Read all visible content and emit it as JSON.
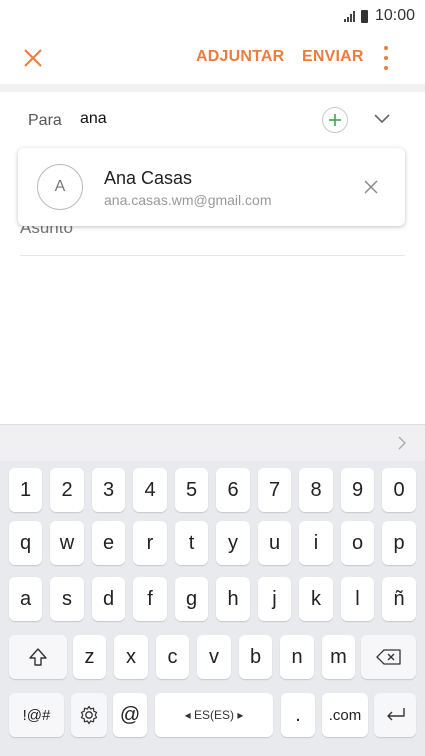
{
  "status": {
    "time": "10:00"
  },
  "action_bar": {
    "attach_label": "ADJUNTAR",
    "send_label": "ENVIAR",
    "accent_color": "#ef7c3a"
  },
  "recipient": {
    "label": "Para",
    "value": "ana"
  },
  "suggestion": {
    "avatar_letter": "A",
    "name": "Ana Casas",
    "email": "ana.casas.wm@gmail.com"
  },
  "subject": {
    "placeholder": "Asunto"
  },
  "keyboard": {
    "row_numbers": [
      "1",
      "2",
      "3",
      "4",
      "5",
      "6",
      "7",
      "8",
      "9",
      "0"
    ],
    "row_top": [
      "q",
      "w",
      "e",
      "r",
      "t",
      "y",
      "u",
      "i",
      "o",
      "p"
    ],
    "row_middle": [
      "a",
      "s",
      "d",
      "f",
      "g",
      "h",
      "j",
      "k",
      "l",
      "ñ"
    ],
    "row_bottom": [
      "z",
      "x",
      "c",
      "v",
      "b",
      "n",
      "m"
    ],
    "symbols_label": "!@#",
    "at_label": "@",
    "space_label": "◂ ES(ES) ▸",
    "dot_label": ".",
    "dotcom_label": ".com"
  }
}
